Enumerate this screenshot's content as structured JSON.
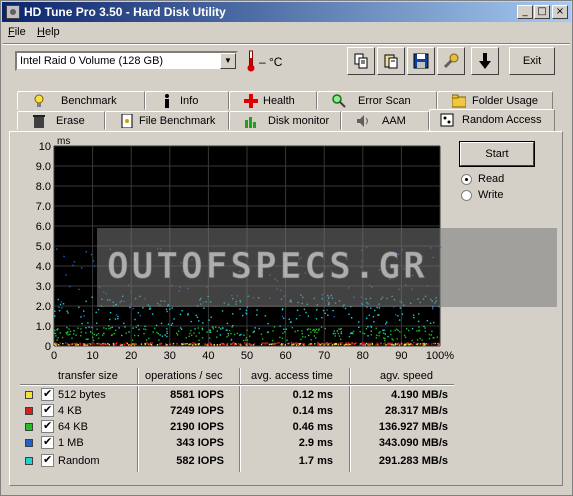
{
  "window": {
    "title": "HD Tune Pro 3.50 - Hard Disk Utility"
  },
  "menu": {
    "file": "File",
    "help": "Help"
  },
  "toolbar": {
    "drive": "Intel   Raid 0 Volume (128 GB)",
    "temperature": "– °C",
    "exit_label": "Exit"
  },
  "tabs_row1": [
    "Benchmark",
    "Info",
    "Health",
    "Error Scan",
    "Folder Usage"
  ],
  "tabs_row2": [
    "Erase",
    "File Benchmark",
    "Disk monitor",
    "AAM",
    "Random Access"
  ],
  "controls": {
    "start": "Start",
    "read": "Read",
    "write": "Write",
    "mode": "Read"
  },
  "results": {
    "headers": [
      "transfer size",
      "operations / sec",
      "avg. access time",
      "agv. speed"
    ],
    "rows": [
      {
        "name": "512 bytes",
        "color": "#f0e040",
        "ops": "8581 IOPS",
        "access": "0.12 ms",
        "speed": "4.190 MB/s",
        "checked": true
      },
      {
        "name": "4 KB",
        "color": "#d02020",
        "ops": "7249 IOPS",
        "access": "0.14 ms",
        "speed": "28.317 MB/s",
        "checked": true
      },
      {
        "name": "64 KB",
        "color": "#20c020",
        "ops": "2190 IOPS",
        "access": "0.46 ms",
        "speed": "136.927 MB/s",
        "checked": true
      },
      {
        "name": "1 MB",
        "color": "#2060d0",
        "ops": "343 IOPS",
        "access": "2.9 ms",
        "speed": "343.090 MB/s",
        "checked": true
      },
      {
        "name": "Random",
        "color": "#20d0d0",
        "ops": "582 IOPS",
        "access": "1.7 ms",
        "speed": "291.283 MB/s",
        "checked": true
      }
    ]
  },
  "watermark": "OUTOFSPECS.GR",
  "chart_data": {
    "type": "scatter",
    "ylabel": "ms",
    "ylim": [
      0,
      10
    ],
    "xlim": [
      0,
      100
    ],
    "y_ticks": [
      "10",
      "9.0",
      "8.0",
      "7.0",
      "6.0",
      "5.0",
      "4.0",
      "3.0",
      "2.0",
      "1.0",
      "0"
    ],
    "x_ticks": [
      "0",
      "10",
      "20",
      "30",
      "40",
      "50",
      "60",
      "70",
      "80",
      "90",
      "100%"
    ],
    "grid": true,
    "series": [
      {
        "name": "512 bytes",
        "color": "#f0e040",
        "band": [
          0.08,
          0.16
        ]
      },
      {
        "name": "4 KB",
        "color": "#d02020",
        "band": [
          0.1,
          0.2
        ]
      },
      {
        "name": "64 KB",
        "color": "#20c020",
        "band": [
          0.3,
          1.0
        ]
      },
      {
        "name": "1 MB",
        "color": "#2060d0",
        "band": [
          1.5,
          5.0
        ]
      },
      {
        "name": "Random",
        "color": "#20d0d0",
        "band": [
          0.5,
          2.6
        ]
      }
    ]
  }
}
